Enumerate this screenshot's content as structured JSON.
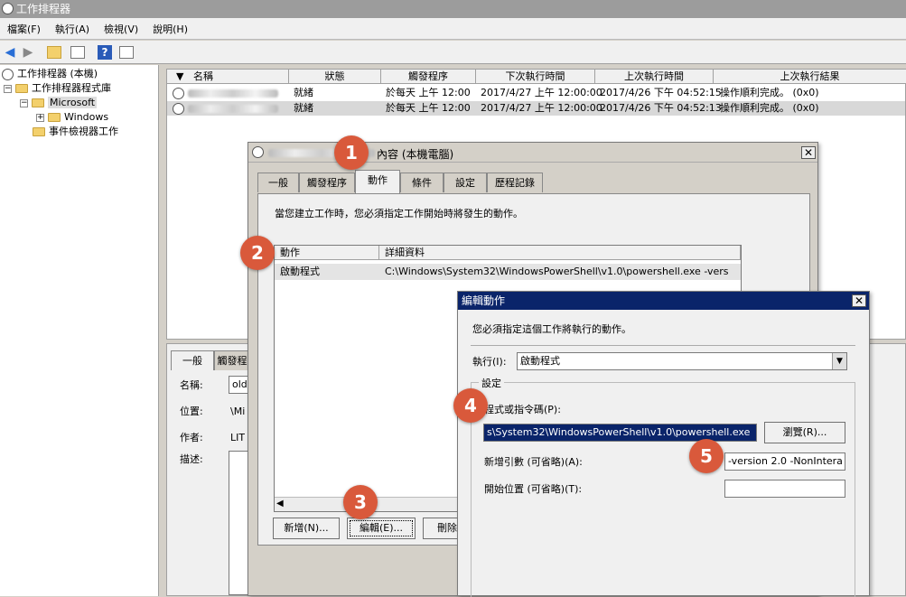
{
  "window": {
    "title": "工作排程器"
  },
  "menu": [
    "檔案(F)",
    "執行(A)",
    "檢視(V)",
    "說明(H)"
  ],
  "tree": {
    "root": "工作排程器 (本機)",
    "library": "工作排程器程式庫",
    "microsoft": "Microsoft",
    "windows": "Windows",
    "eventviewer": "事件檢視器工作"
  },
  "list": {
    "headers": [
      "名稱",
      "狀態",
      "觸發程序",
      "下次執行時間",
      "上次執行時間",
      "上次執行結果"
    ],
    "rows": [
      {
        "status": "就緒",
        "trigger": "於每天 上午 12:00",
        "next": "2017/4/27 上午 12:00:00",
        "last": "2017/4/26 下午 04:52:15",
        "result": "操作順利完成。 (0x0)"
      },
      {
        "status": "就緒",
        "trigger": "於每天 上午 12:00",
        "next": "2017/4/27 上午 12:00:00",
        "last": "2017/4/26 下午 04:52:13",
        "result": "操作順利完成。 (0x0)"
      }
    ]
  },
  "lower": {
    "tabs": [
      "一般",
      "觸發程"
    ],
    "labels": [
      "名稱:",
      "位置:",
      "作者:",
      "描述:"
    ],
    "values": [
      "old",
      "\\Mi",
      "LIT"
    ]
  },
  "props": {
    "title_suffix": "內容 (本機電腦)",
    "tabs": [
      "一般",
      "觸發程序",
      "動作",
      "條件",
      "設定",
      "歷程記錄"
    ],
    "desc": "當您建立工作時，您必須指定工作開始時將發生的動作。",
    "col_action": "動作",
    "col_detail": "詳細資料",
    "row_action": "啟動程式",
    "row_detail": "C:\\Windows\\System32\\WindowsPowerShell\\v1.0\\powershell.exe -vers",
    "btn_new": "新增(N)...",
    "btn_edit": "編輯(E)...",
    "btn_delete": "刪除"
  },
  "edit": {
    "title": "編輯動作",
    "desc": "您必須指定這個工作將執行的動作。",
    "action_label": "執行(I):",
    "action_value": "啟動程式",
    "group": "設定",
    "program_label": "程式或指令碼(P):",
    "program_value": "s\\System32\\WindowsPowerShell\\v1.0\\powershell.exe",
    "browse": "瀏覽(R)...",
    "args_label": "新增引數 (可省略)(A):",
    "args_value": "-version 2.0 -NonIntera",
    "start_label": "開始位置 (可省略)(T):",
    "start_value": ""
  },
  "markers": [
    "1",
    "2",
    "3",
    "4",
    "5"
  ]
}
